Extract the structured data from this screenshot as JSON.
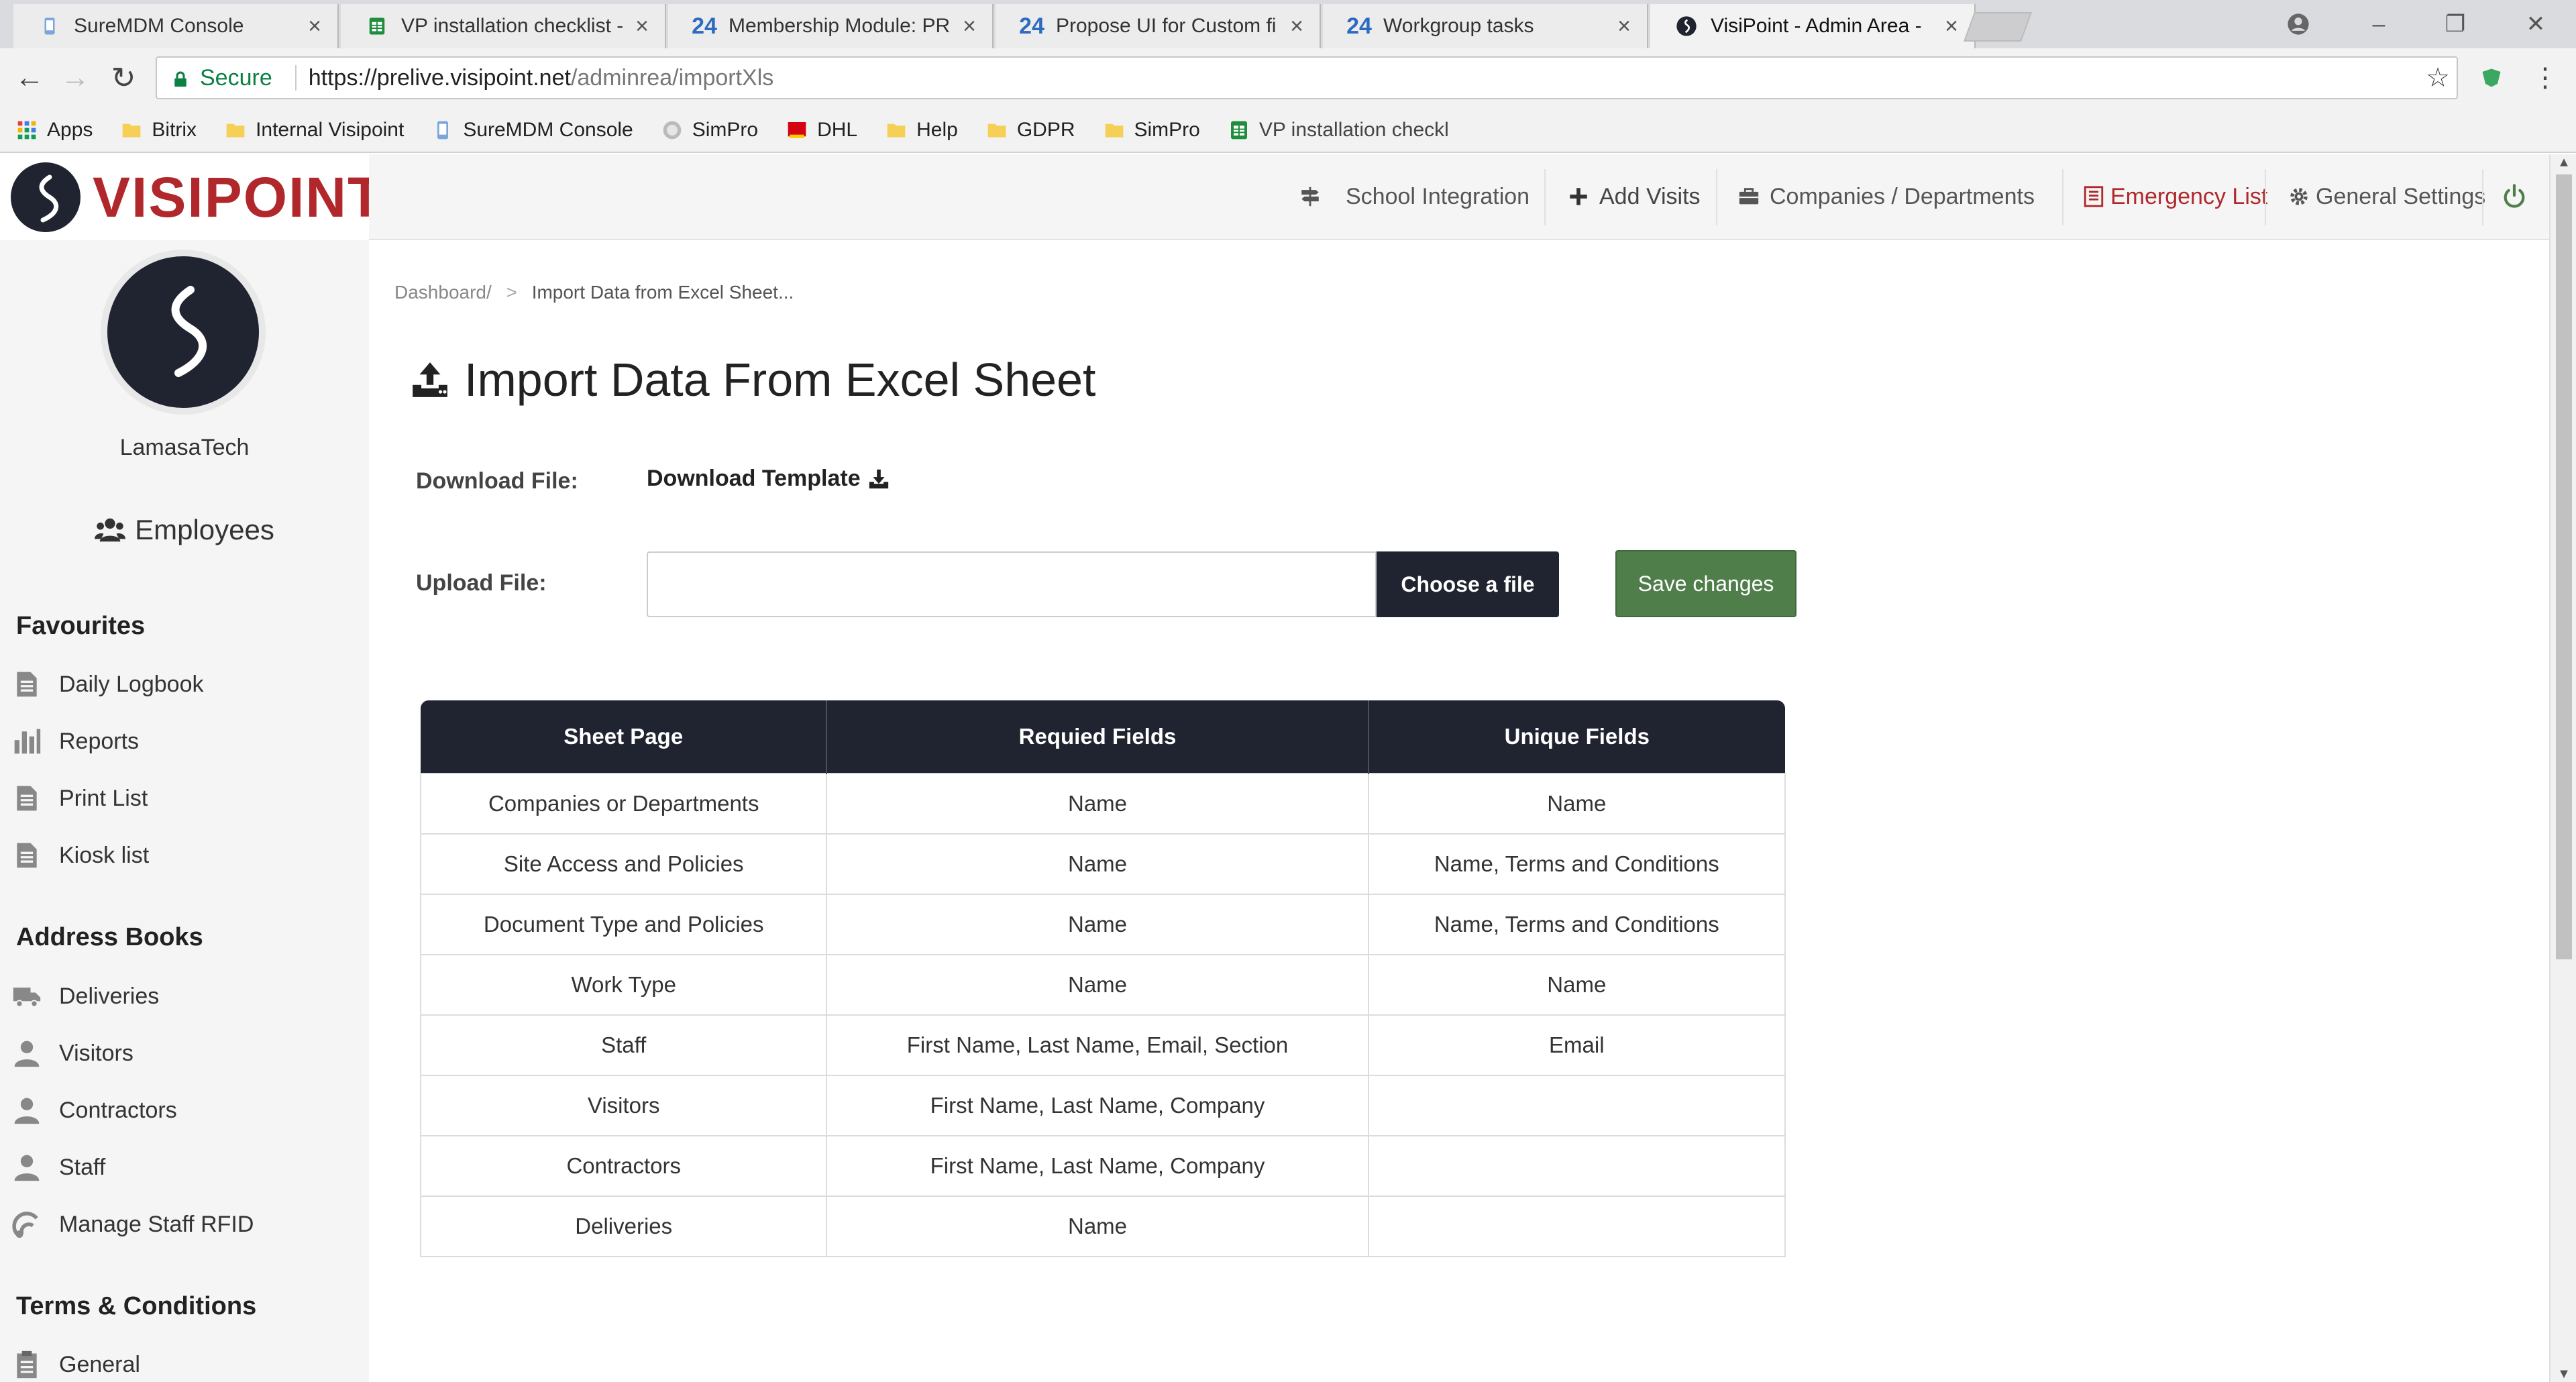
{
  "browser": {
    "tabs": [
      {
        "num": "",
        "title": "SureMDM Console",
        "active": false
      },
      {
        "num": "",
        "title": "VP installation checklist -",
        "active": false
      },
      {
        "num": "24",
        "title": "Membership Module: PR",
        "active": false
      },
      {
        "num": "24",
        "title": "Propose UI for Custom fi",
        "active": false
      },
      {
        "num": "24",
        "title": "Workgroup tasks",
        "active": false
      },
      {
        "num": "",
        "title": "VisiPoint - Admin Area -",
        "active": true
      }
    ],
    "secure_label": "Secure",
    "url_host": "https://prelive.visipoint.net",
    "url_path": "/adminrea/importXls",
    "bookmarks": [
      "Apps",
      "Bitrix",
      "Internal Visipoint",
      "SureMDM Console",
      "SimPro",
      "DHL",
      "Help",
      "GDPR",
      "SimPro",
      "VP installation checkl"
    ]
  },
  "app": {
    "logo_text": "VISIPOINT",
    "brand_color": "#b0282c",
    "dark_color": "#1f2430",
    "topnav": {
      "school_integration": "School Integration",
      "add_visits": "Add Visits",
      "companies_departments": "Companies / Departments",
      "emergency_list": "Emergency List",
      "general_settings": "General Settings"
    }
  },
  "sidebar": {
    "username": "LamasaTech",
    "employees": "Employees",
    "favourites_heading": "Favourites",
    "favourites": [
      {
        "label": "Daily Logbook",
        "icon": "document-icon"
      },
      {
        "label": "Reports",
        "icon": "bar-chart-icon"
      },
      {
        "label": "Print List",
        "icon": "document-icon"
      },
      {
        "label": "Kiosk list",
        "icon": "document-icon"
      }
    ],
    "address_books_heading": "Address Books",
    "address_books": [
      {
        "label": "Deliveries",
        "icon": "truck-icon"
      },
      {
        "label": "Visitors",
        "icon": "user-icon"
      },
      {
        "label": "Contractors",
        "icon": "user-icon"
      },
      {
        "label": "Staff",
        "icon": "user-icon"
      },
      {
        "label": "Manage Staff RFID",
        "icon": "rfid-icon"
      }
    ],
    "terms_heading": "Terms & Conditions",
    "terms": [
      {
        "label": "General",
        "icon": "clipboard-icon"
      }
    ]
  },
  "main": {
    "breadcrumb": {
      "root": "Dashboard/",
      "separator": ">",
      "current": "Import Data from Excel Sheet..."
    },
    "title": "Import Data From Excel Sheet",
    "download_label": "Download File:",
    "download_link": "Download Template",
    "upload_label": "Upload File:",
    "upload_value": "",
    "choose_button": "Choose a file",
    "save_button": "Save changes",
    "save_color": "#4f7e4a",
    "table": {
      "headers": [
        "Sheet Page",
        "Requied Fields",
        "Unique Fields"
      ],
      "rows": [
        [
          "Companies or Departments",
          "Name",
          "Name"
        ],
        [
          "Site Access and Policies",
          "Name",
          "Name, Terms and Conditions"
        ],
        [
          "Document Type and Policies",
          "Name",
          "Name, Terms and Conditions"
        ],
        [
          "Work Type",
          "Name",
          "Name"
        ],
        [
          "Staff",
          "First Name, Last Name, Email, Section",
          "Email"
        ],
        [
          "Visitors",
          "First Name, Last Name, Company",
          ""
        ],
        [
          "Contractors",
          "First Name, Last Name, Company",
          ""
        ],
        [
          "Deliveries",
          "Name",
          ""
        ]
      ]
    }
  }
}
